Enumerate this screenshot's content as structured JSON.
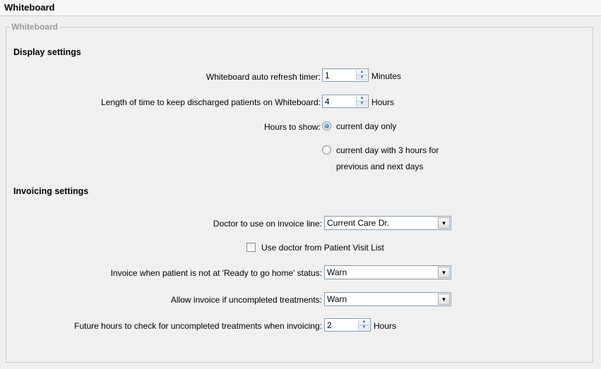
{
  "window": {
    "title": "Whiteboard"
  },
  "group": {
    "legend": "Whiteboard"
  },
  "display": {
    "title": "Display settings",
    "refresh": {
      "label": "Whiteboard auto refresh timer:",
      "value": "1",
      "unit": "Minutes"
    },
    "discharged": {
      "label": "Length of time to keep discharged patients on Whiteboard:",
      "value": "4",
      "unit": "Hours"
    },
    "hours": {
      "label": "Hours to show:",
      "option1": "current day only",
      "option2_line1": "current day with 3 hours for",
      "option2_line2": "previous and next days",
      "selected": "current day only"
    }
  },
  "invoicing": {
    "title": "Invoicing settings",
    "doctor": {
      "label": "Doctor to use on invoice line:",
      "value": "Current Care Dr."
    },
    "use_doctor": {
      "label": "Use doctor from Patient Visit List",
      "checked": false
    },
    "not_ready": {
      "label": "Invoice when patient is not at 'Ready to go home' status:",
      "value": "Warn"
    },
    "uncompleted": {
      "label": "Allow invoice if uncompleted treatments:",
      "value": "Warn"
    },
    "future_hours": {
      "label": "Future hours to check for uncompleted treatments when invoicing:",
      "value": "2",
      "unit": "Hours"
    }
  }
}
